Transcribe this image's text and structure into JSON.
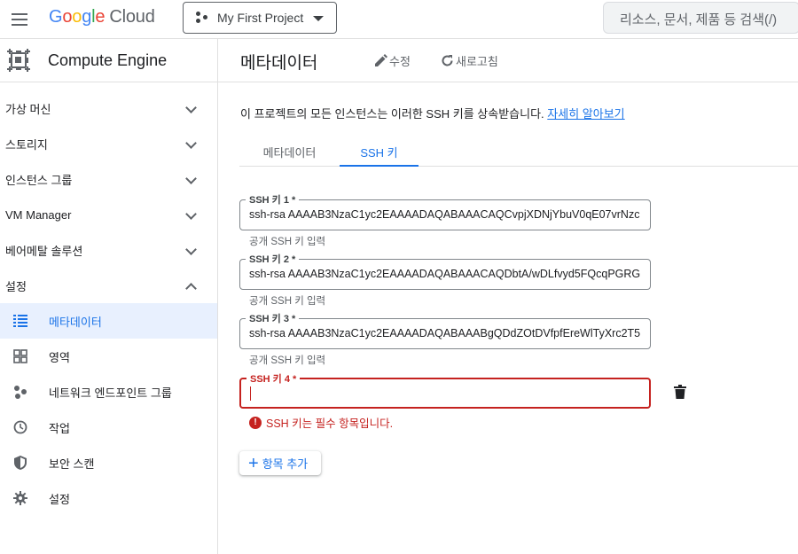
{
  "topbar": {
    "logo_letters": [
      "G",
      "o",
      "o",
      "g",
      "l",
      "e"
    ],
    "logo_cloud": "Cloud",
    "project": "My First Project",
    "search_placeholder": "리소스, 문서, 제품 등 검색(/)"
  },
  "sidebar": {
    "product_title": "Compute Engine",
    "groups": [
      {
        "label": "가상 머신"
      },
      {
        "label": "스토리지"
      },
      {
        "label": "인스턴스 그룹"
      },
      {
        "label": "VM Manager"
      },
      {
        "label": "베어메탈 솔루션"
      },
      {
        "label": "설정"
      }
    ],
    "items": [
      {
        "label": "메타데이터",
        "icon": "list-icon"
      },
      {
        "label": "영역",
        "icon": "zones-icon"
      },
      {
        "label": "네트워크 엔드포인트 그룹",
        "icon": "network-icon"
      },
      {
        "label": "작업",
        "icon": "clock-icon"
      },
      {
        "label": "보안 스캔",
        "icon": "shield-icon"
      },
      {
        "label": "설정",
        "icon": "gear-icon"
      }
    ]
  },
  "main": {
    "title": "메타데이터",
    "edit_label": "수정",
    "refresh_label": "새로고침",
    "info_text": "이 프로젝트의 모든 인스턴스는 이러한 SSH 키를 상속받습니다.",
    "info_link": "자세히 알아보기",
    "tabs": [
      {
        "label": "메타데이터",
        "active": false
      },
      {
        "label": "SSH 키",
        "active": true
      }
    ],
    "ssh_keys": [
      {
        "label": "SSH 키 1 *",
        "value": "ssh-rsa AAAAB3NzaC1yc2EAAAADAQABAAACAQCvpjXDNjYbuV0qE07vrNzc",
        "hint": "공개 SSH 키 입력"
      },
      {
        "label": "SSH 키 2 *",
        "value": "ssh-rsa AAAAB3NzaC1yc2EAAAADAQABAAACAQDbtA/wDLfvyd5FQcqPGRG",
        "hint": "공개 SSH 키 입력"
      },
      {
        "label": "SSH 키 3 *",
        "value": "ssh-rsa AAAAB3NzaC1yc2EAAAADAQABAAABgQDdZOtDVfpfEreWlTyXrc2T5",
        "hint": "공개 SSH 키 입력"
      },
      {
        "label": "SSH 키 4 *",
        "value": ""
      }
    ],
    "error_text": "SSH 키는 필수 항목입니다.",
    "add_label": "항목 추가"
  },
  "colors": {
    "accent": "#1a73e8",
    "error": "#c5221f",
    "active_bg": "#e8f0fe"
  }
}
